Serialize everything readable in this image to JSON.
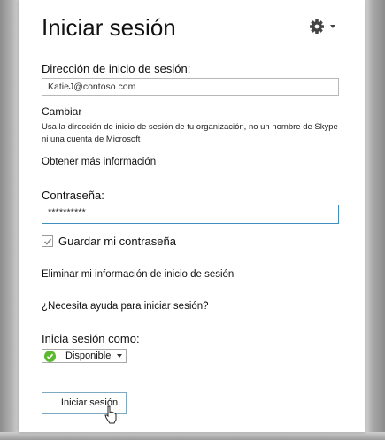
{
  "window": {
    "title": "Iniciar sesión"
  },
  "signin_address": {
    "label": "Dirección de inicio de sesión:",
    "value": "KatieJ@contoso.com"
  },
  "change_link": "Cambiar",
  "help_text_line1": "Usa la dirección de inicio de sesión de tu organización, no un nombre de Skype",
  "help_text_line2": "ni una cuenta de Microsoft",
  "more_info_link": "Obtener más información",
  "password": {
    "label": "Contraseña:",
    "masked_value": "**********"
  },
  "save_password": {
    "label": "Guardar mi contraseña",
    "checked": true
  },
  "delete_info_link": "Eliminar mi información de inicio de sesión",
  "help_link": "¿Necesita ayuda para iniciar sesión?",
  "signin_as": {
    "label": "Inicia sesión como:",
    "selected": "Disponible",
    "status_color": "#5cb82e"
  },
  "signin_button": "Iniciar sesión",
  "icons": {
    "settings": "gear-icon",
    "dropdown": "caret-down-icon",
    "status": "presence-available-icon"
  }
}
